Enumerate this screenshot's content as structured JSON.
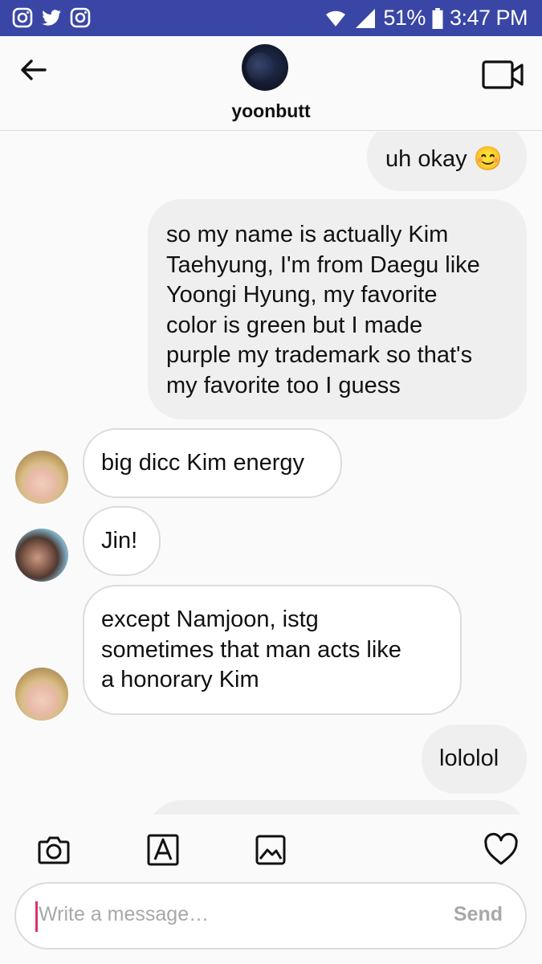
{
  "status_bar": {
    "battery": "51%",
    "time": "3:47 PM",
    "left_icons": [
      "instagram-icon",
      "twitter-icon",
      "instagram-icon"
    ],
    "right_icons": [
      "wifi-icon",
      "signal-icon",
      "battery-icon"
    ]
  },
  "header": {
    "username": "yoonbutt",
    "back_icon": "back-arrow-icon",
    "video_icon": "video-call-icon"
  },
  "messages": [
    {
      "direction": "sent",
      "text": "uh okay 😊"
    },
    {
      "direction": "sent",
      "lines": [
        "so my name is actually Kim",
        "Taehyung, I'm from Daegu like",
        "Yoongi Hyung, my favorite",
        "color is green but I made",
        "purple my trademark so that's",
        "my favorite too I guess"
      ]
    },
    {
      "direction": "received",
      "text": "big dicc Kim energy"
    },
    {
      "direction": "received",
      "text": "Jin!"
    },
    {
      "direction": "received",
      "lines": [
        "except Namjoon, istg",
        "sometimes that man acts like",
        "a honorary Kim"
      ]
    },
    {
      "direction": "sent",
      "text": "lololol"
    }
  ],
  "composer": {
    "placeholder": "Write a message…",
    "send_label": "Send",
    "tools": [
      "camera-icon",
      "text-style-icon",
      "gallery-icon",
      "heart-icon"
    ]
  }
}
